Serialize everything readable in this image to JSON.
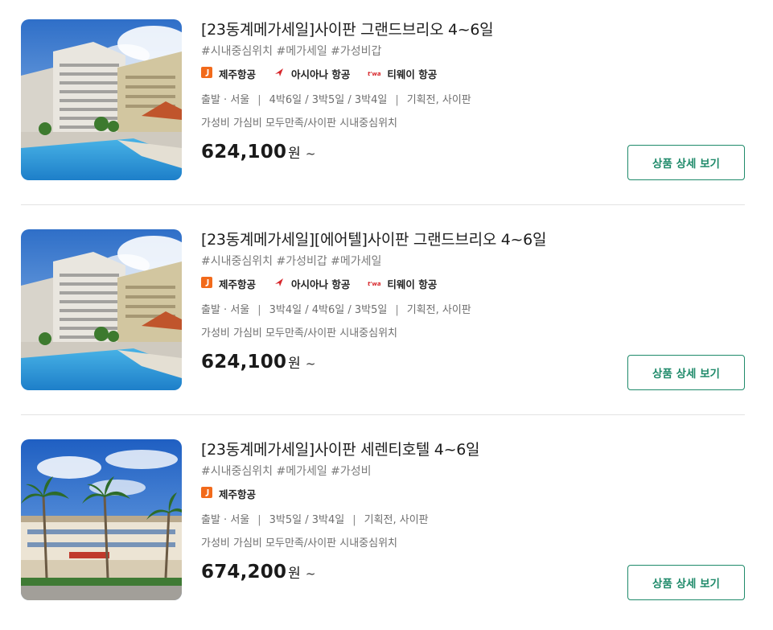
{
  "products": [
    {
      "title": "[23동계메가세일]사이판 그랜드브리오 4~6일",
      "tags": "#시내중심위치 #메가세일 #가성비갑",
      "airlines": [
        {
          "name": "제주항공",
          "logo": "jeju-air-logo",
          "color": "#f26a1b"
        },
        {
          "name": "아시아나 항공",
          "logo": "asiana-logo",
          "color": "#d7262b"
        },
        {
          "name": "티웨이 항공",
          "logo": "tway-logo",
          "color": "#d7262b"
        }
      ],
      "departure": "출발 · 서울",
      "durations": "4박6일 / 3박5일 / 3박4일",
      "category": "기획전, 사이판",
      "description": "가성비 가심비 모두만족/사이판 시내중심위치",
      "price": "624,100",
      "currency": "원",
      "price_suffix": "~",
      "button_label": "상품 상세 보기",
      "image": "hotel-pool-photo"
    },
    {
      "title": "[23동계메가세일][에어텔]사이판 그랜드브리오 4~6일",
      "tags": "#시내중심위치 #가성비갑 #메가세일",
      "airlines": [
        {
          "name": "제주항공",
          "logo": "jeju-air-logo",
          "color": "#f26a1b"
        },
        {
          "name": "아시아나 항공",
          "logo": "asiana-logo",
          "color": "#d7262b"
        },
        {
          "name": "티웨이 항공",
          "logo": "tway-logo",
          "color": "#d7262b"
        }
      ],
      "departure": "출발 · 서울",
      "durations": "3박4일 / 4박6일 / 3박5일",
      "category": "기획전, 사이판",
      "description": "가성비 가심비 모두만족/사이판 시내중심위치",
      "price": "624,100",
      "currency": "원",
      "price_suffix": "~",
      "button_label": "상품 상세 보기",
      "image": "hotel-pool-photo"
    },
    {
      "title": "[23동계메가세일]사이판 세렌티호텔 4~6일",
      "tags": "#시내중심위치 #메가세일 #가성비",
      "airlines": [
        {
          "name": "제주항공",
          "logo": "jeju-air-logo",
          "color": "#f26a1b"
        }
      ],
      "departure": "출발 · 서울",
      "durations": "3박5일 / 3박4일",
      "category": "기획전, 사이판",
      "description": "가성비 가심비 모두만족/사이판 시내중심위치",
      "price": "674,200",
      "currency": "원",
      "price_suffix": "~",
      "button_label": "상품 상세 보기",
      "image": "hotel-palm-photo"
    }
  ],
  "colors": {
    "accent": "#1f8a6a",
    "divider": "#e3e3e3",
    "muted_text": "#7a7a7a"
  }
}
